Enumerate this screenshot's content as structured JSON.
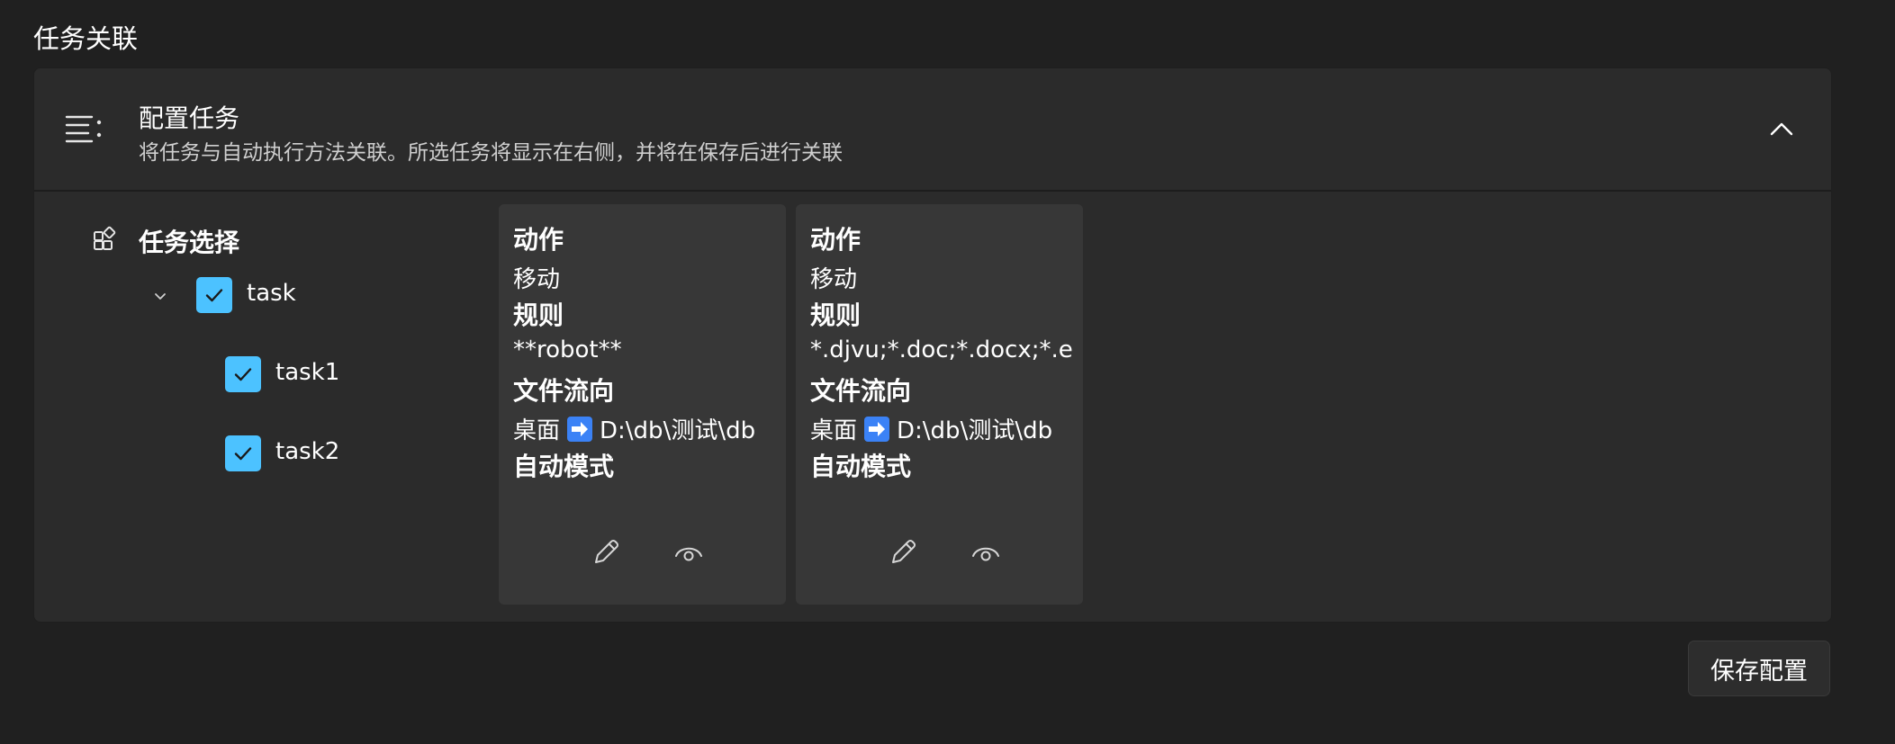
{
  "section_title": "任务关联",
  "expander": {
    "title": "配置任务",
    "description": "将任务与自动执行方法关联。所选任务将显示在右侧，并将在保存后进行关联",
    "icons": {
      "header": "list-settings-icon",
      "collapse": "chevron-up-icon"
    }
  },
  "task_tree": {
    "header": "任务选择",
    "header_icon": "apps-add-icon",
    "root": {
      "label": "task",
      "checked": true,
      "expanded": true
    },
    "children": [
      {
        "label": "task1",
        "checked": true
      },
      {
        "label": "task2",
        "checked": true
      }
    ]
  },
  "cards": [
    {
      "action_label": "动作",
      "action_value": "移动",
      "rule_label": "规则",
      "rule_value": "**robot**",
      "flow_label": "文件流向",
      "flow_from": "桌面",
      "flow_to": "D:\\db\\测试\\db",
      "mode_label": "自动模式",
      "mode_value": "",
      "buttons": [
        "edit-icon",
        "view-icon"
      ]
    },
    {
      "action_label": "动作",
      "action_value": "移动",
      "rule_label": "规则",
      "rule_value": "*.djvu;*.doc;*.docx;*.epub",
      "flow_label": "文件流向",
      "flow_from": "桌面",
      "flow_to": "D:\\db\\测试\\db",
      "mode_label": "自动模式",
      "mode_value": "",
      "buttons": [
        "edit-icon",
        "view-icon"
      ]
    }
  ],
  "save_button": "保存配置",
  "colors": {
    "background": "#202020",
    "panel": "#2b2b2b",
    "card": "#373737",
    "accent": "#4cc2ff"
  }
}
